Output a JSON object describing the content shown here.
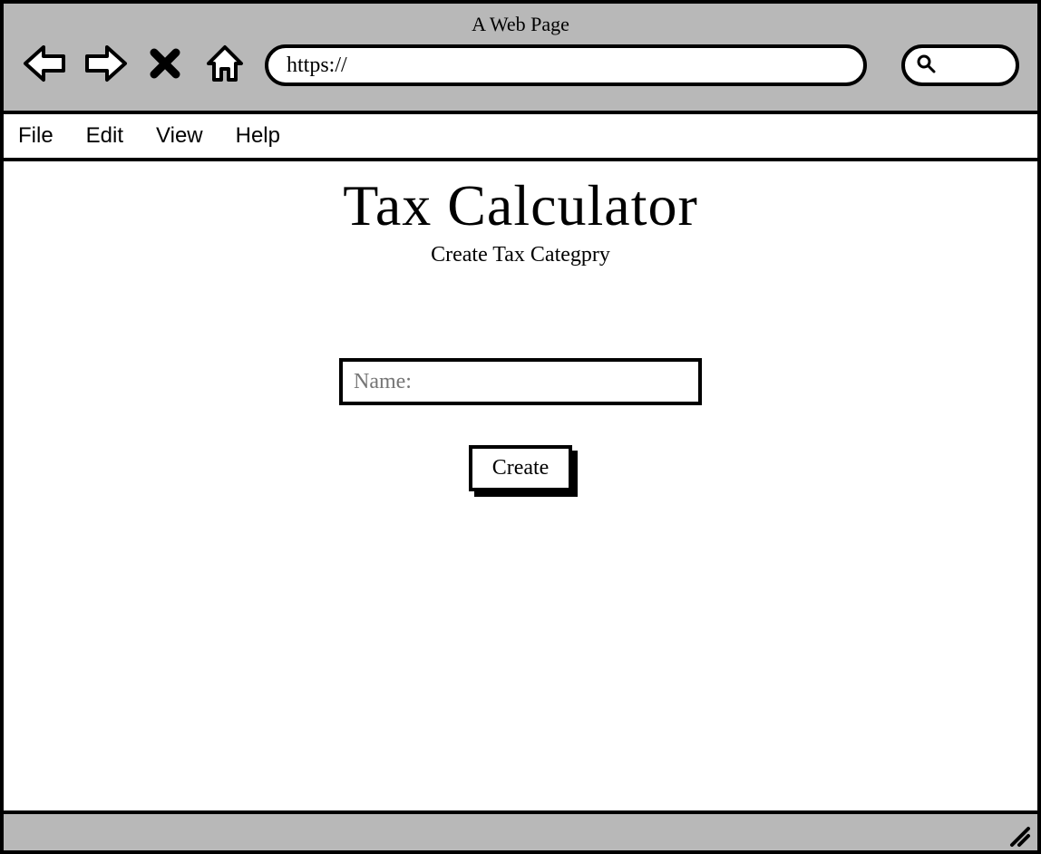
{
  "browser": {
    "title": "A Web Page",
    "url": "https://"
  },
  "menu": {
    "items": [
      {
        "label": "File"
      },
      {
        "label": "Edit"
      },
      {
        "label": "View"
      },
      {
        "label": "Help"
      }
    ]
  },
  "page": {
    "title": "Tax Calculator",
    "subtitle": "Create Tax Categpry"
  },
  "form": {
    "name_placeholder": "Name:",
    "name_value": "",
    "create_label": "Create"
  }
}
